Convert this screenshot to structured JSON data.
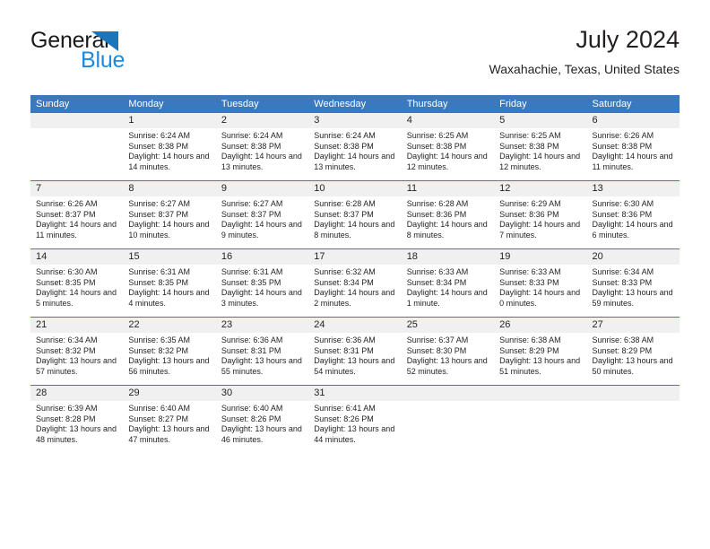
{
  "brand": {
    "name_top": "General",
    "name_bottom": "Blue",
    "triangle_color": "#1b75bb",
    "top_color": "#1a1a1a",
    "bottom_color": "#1b8ae0"
  },
  "header": {
    "title": "July 2024",
    "subtitle": "Waxahachie, Texas, United States"
  },
  "theme": {
    "header_blue": "#3b79bf",
    "day_band_gray": "#f0f0f0",
    "text_color": "#231f20",
    "page_background": "#ffffff"
  },
  "calendar": {
    "weekday_headers": [
      "Sunday",
      "Monday",
      "Tuesday",
      "Wednesday",
      "Thursday",
      "Friday",
      "Saturday"
    ],
    "weeks": [
      [
        {
          "day": "",
          "sunrise": "",
          "sunset": "",
          "daylight": "",
          "empty": true
        },
        {
          "day": "1",
          "sunrise": "Sunrise: 6:24 AM",
          "sunset": "Sunset: 8:38 PM",
          "daylight": "Daylight: 14 hours and 14 minutes."
        },
        {
          "day": "2",
          "sunrise": "Sunrise: 6:24 AM",
          "sunset": "Sunset: 8:38 PM",
          "daylight": "Daylight: 14 hours and 13 minutes."
        },
        {
          "day": "3",
          "sunrise": "Sunrise: 6:24 AM",
          "sunset": "Sunset: 8:38 PM",
          "daylight": "Daylight: 14 hours and 13 minutes."
        },
        {
          "day": "4",
          "sunrise": "Sunrise: 6:25 AM",
          "sunset": "Sunset: 8:38 PM",
          "daylight": "Daylight: 14 hours and 12 minutes."
        },
        {
          "day": "5",
          "sunrise": "Sunrise: 6:25 AM",
          "sunset": "Sunset: 8:38 PM",
          "daylight": "Daylight: 14 hours and 12 minutes."
        },
        {
          "day": "6",
          "sunrise": "Sunrise: 6:26 AM",
          "sunset": "Sunset: 8:38 PM",
          "daylight": "Daylight: 14 hours and 11 minutes."
        }
      ],
      [
        {
          "day": "7",
          "sunrise": "Sunrise: 6:26 AM",
          "sunset": "Sunset: 8:37 PM",
          "daylight": "Daylight: 14 hours and 11 minutes."
        },
        {
          "day": "8",
          "sunrise": "Sunrise: 6:27 AM",
          "sunset": "Sunset: 8:37 PM",
          "daylight": "Daylight: 14 hours and 10 minutes."
        },
        {
          "day": "9",
          "sunrise": "Sunrise: 6:27 AM",
          "sunset": "Sunset: 8:37 PM",
          "daylight": "Daylight: 14 hours and 9 minutes."
        },
        {
          "day": "10",
          "sunrise": "Sunrise: 6:28 AM",
          "sunset": "Sunset: 8:37 PM",
          "daylight": "Daylight: 14 hours and 8 minutes."
        },
        {
          "day": "11",
          "sunrise": "Sunrise: 6:28 AM",
          "sunset": "Sunset: 8:36 PM",
          "daylight": "Daylight: 14 hours and 8 minutes."
        },
        {
          "day": "12",
          "sunrise": "Sunrise: 6:29 AM",
          "sunset": "Sunset: 8:36 PM",
          "daylight": "Daylight: 14 hours and 7 minutes."
        },
        {
          "day": "13",
          "sunrise": "Sunrise: 6:30 AM",
          "sunset": "Sunset: 8:36 PM",
          "daylight": "Daylight: 14 hours and 6 minutes."
        }
      ],
      [
        {
          "day": "14",
          "sunrise": "Sunrise: 6:30 AM",
          "sunset": "Sunset: 8:35 PM",
          "daylight": "Daylight: 14 hours and 5 minutes."
        },
        {
          "day": "15",
          "sunrise": "Sunrise: 6:31 AM",
          "sunset": "Sunset: 8:35 PM",
          "daylight": "Daylight: 14 hours and 4 minutes."
        },
        {
          "day": "16",
          "sunrise": "Sunrise: 6:31 AM",
          "sunset": "Sunset: 8:35 PM",
          "daylight": "Daylight: 14 hours and 3 minutes."
        },
        {
          "day": "17",
          "sunrise": "Sunrise: 6:32 AM",
          "sunset": "Sunset: 8:34 PM",
          "daylight": "Daylight: 14 hours and 2 minutes."
        },
        {
          "day": "18",
          "sunrise": "Sunrise: 6:33 AM",
          "sunset": "Sunset: 8:34 PM",
          "daylight": "Daylight: 14 hours and 1 minute."
        },
        {
          "day": "19",
          "sunrise": "Sunrise: 6:33 AM",
          "sunset": "Sunset: 8:33 PM",
          "daylight": "Daylight: 14 hours and 0 minutes."
        },
        {
          "day": "20",
          "sunrise": "Sunrise: 6:34 AM",
          "sunset": "Sunset: 8:33 PM",
          "daylight": "Daylight: 13 hours and 59 minutes."
        }
      ],
      [
        {
          "day": "21",
          "sunrise": "Sunrise: 6:34 AM",
          "sunset": "Sunset: 8:32 PM",
          "daylight": "Daylight: 13 hours and 57 minutes."
        },
        {
          "day": "22",
          "sunrise": "Sunrise: 6:35 AM",
          "sunset": "Sunset: 8:32 PM",
          "daylight": "Daylight: 13 hours and 56 minutes."
        },
        {
          "day": "23",
          "sunrise": "Sunrise: 6:36 AM",
          "sunset": "Sunset: 8:31 PM",
          "daylight": "Daylight: 13 hours and 55 minutes."
        },
        {
          "day": "24",
          "sunrise": "Sunrise: 6:36 AM",
          "sunset": "Sunset: 8:31 PM",
          "daylight": "Daylight: 13 hours and 54 minutes."
        },
        {
          "day": "25",
          "sunrise": "Sunrise: 6:37 AM",
          "sunset": "Sunset: 8:30 PM",
          "daylight": "Daylight: 13 hours and 52 minutes."
        },
        {
          "day": "26",
          "sunrise": "Sunrise: 6:38 AM",
          "sunset": "Sunset: 8:29 PM",
          "daylight": "Daylight: 13 hours and 51 minutes."
        },
        {
          "day": "27",
          "sunrise": "Sunrise: 6:38 AM",
          "sunset": "Sunset: 8:29 PM",
          "daylight": "Daylight: 13 hours and 50 minutes."
        }
      ],
      [
        {
          "day": "28",
          "sunrise": "Sunrise: 6:39 AM",
          "sunset": "Sunset: 8:28 PM",
          "daylight": "Daylight: 13 hours and 48 minutes."
        },
        {
          "day": "29",
          "sunrise": "Sunrise: 6:40 AM",
          "sunset": "Sunset: 8:27 PM",
          "daylight": "Daylight: 13 hours and 47 minutes."
        },
        {
          "day": "30",
          "sunrise": "Sunrise: 6:40 AM",
          "sunset": "Sunset: 8:26 PM",
          "daylight": "Daylight: 13 hours and 46 minutes."
        },
        {
          "day": "31",
          "sunrise": "Sunrise: 6:41 AM",
          "sunset": "Sunset: 8:26 PM",
          "daylight": "Daylight: 13 hours and 44 minutes."
        },
        {
          "day": "",
          "sunrise": "",
          "sunset": "",
          "daylight": "",
          "empty": true
        },
        {
          "day": "",
          "sunrise": "",
          "sunset": "",
          "daylight": "",
          "empty": true
        },
        {
          "day": "",
          "sunrise": "",
          "sunset": "",
          "daylight": "",
          "empty": true
        }
      ]
    ]
  }
}
